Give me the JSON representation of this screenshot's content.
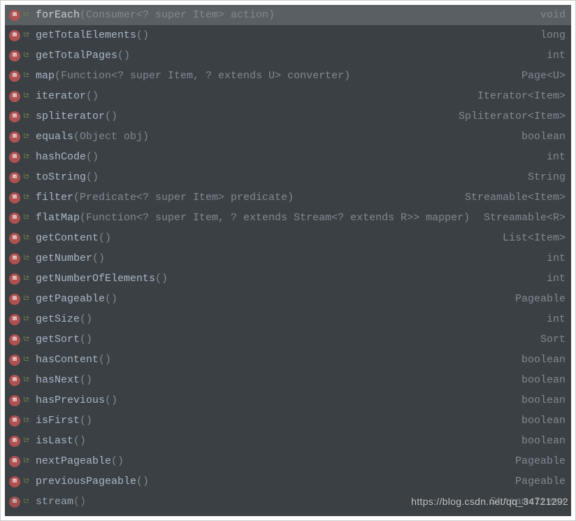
{
  "watermark": "https://blog.csdn.net/qq_34721292",
  "items": [
    {
      "name": "forEach",
      "bold": false,
      "params": "(Consumer<? super Item> action)",
      "ret": "void",
      "selected": true
    },
    {
      "name": "getTotalElements",
      "bold": true,
      "params": "()",
      "ret": "long",
      "selected": false
    },
    {
      "name": "getTotalPages",
      "bold": true,
      "params": "()",
      "ret": "int",
      "selected": false
    },
    {
      "name": "map",
      "bold": true,
      "params": "(Function<? super Item, ? extends U> converter)",
      "ret": "Page<U>",
      "selected": false
    },
    {
      "name": "iterator",
      "bold": false,
      "params": "()",
      "ret": "Iterator<Item>",
      "selected": false
    },
    {
      "name": "spliterator",
      "bold": false,
      "params": "()",
      "ret": "Spliterator<Item>",
      "selected": false
    },
    {
      "name": "equals",
      "bold": false,
      "params": "(Object obj)",
      "ret": "boolean",
      "selected": false
    },
    {
      "name": "hashCode",
      "bold": false,
      "params": "()",
      "ret": "int",
      "selected": false
    },
    {
      "name": "toString",
      "bold": false,
      "params": "()",
      "ret": "String",
      "selected": false
    },
    {
      "name": "filter",
      "bold": false,
      "params": "(Predicate<? super Item> predicate)",
      "ret": "Streamable<Item>",
      "selected": false
    },
    {
      "name": "flatMap",
      "bold": false,
      "params": "(Function<? super Item, ? extends Stream<? extends R>> mapper)",
      "ret": "Streamable<R>",
      "selected": false
    },
    {
      "name": "getContent",
      "bold": false,
      "params": "()",
      "ret": "List<Item>",
      "selected": false
    },
    {
      "name": "getNumber",
      "bold": false,
      "params": "()",
      "ret": "int",
      "selected": false
    },
    {
      "name": "getNumberOfElements",
      "bold": false,
      "params": "()",
      "ret": "int",
      "selected": false
    },
    {
      "name": "getPageable",
      "bold": false,
      "params": "()",
      "ret": "Pageable",
      "selected": false
    },
    {
      "name": "getSize",
      "bold": false,
      "params": "()",
      "ret": "int",
      "selected": false
    },
    {
      "name": "getSort",
      "bold": false,
      "params": "()",
      "ret": "Sort",
      "selected": false
    },
    {
      "name": "hasContent",
      "bold": false,
      "params": "()",
      "ret": "boolean",
      "selected": false
    },
    {
      "name": "hasNext",
      "bold": false,
      "params": "()",
      "ret": "boolean",
      "selected": false
    },
    {
      "name": "hasPrevious",
      "bold": false,
      "params": "()",
      "ret": "boolean",
      "selected": false
    },
    {
      "name": "isFirst",
      "bold": false,
      "params": "()",
      "ret": "boolean",
      "selected": false
    },
    {
      "name": "isLast",
      "bold": false,
      "params": "()",
      "ret": "boolean",
      "selected": false
    },
    {
      "name": "nextPageable",
      "bold": false,
      "params": "()",
      "ret": "Pageable",
      "selected": false
    },
    {
      "name": "previousPageable",
      "bold": false,
      "params": "()",
      "ret": "Pageable",
      "selected": false
    },
    {
      "name": "stream",
      "bold": false,
      "params": "()",
      "ret": "Stream<Item>",
      "selected": false
    }
  ]
}
